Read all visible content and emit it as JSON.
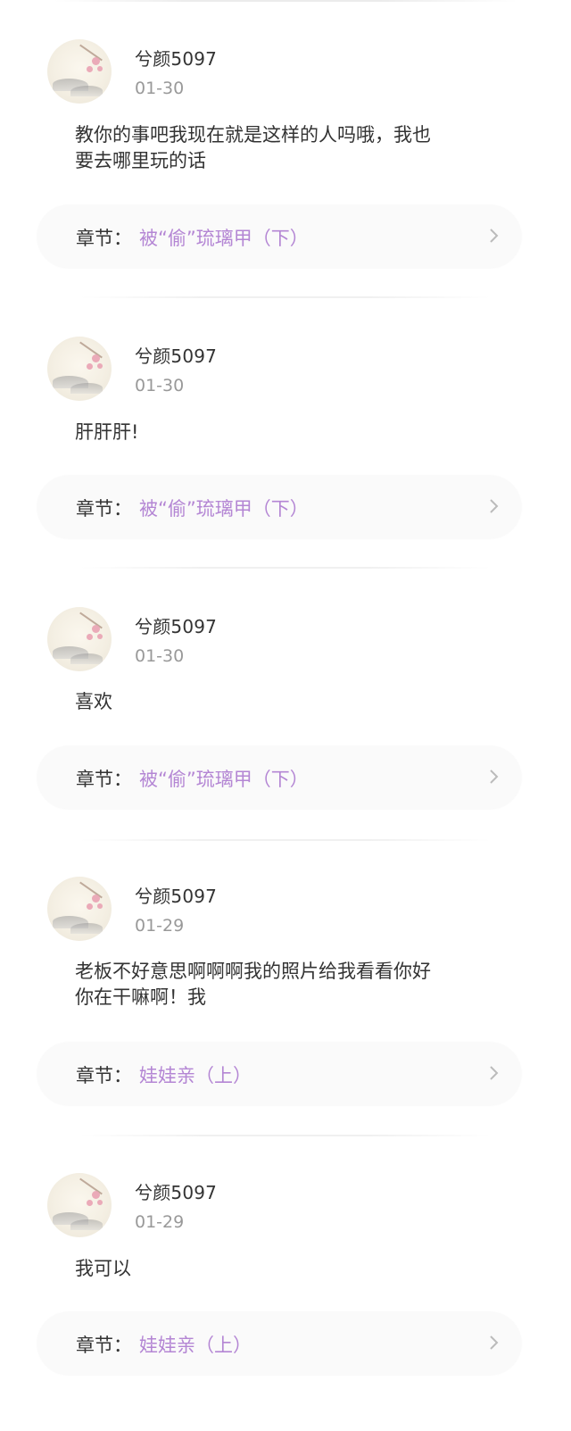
{
  "comments": [
    {
      "username": "兮颜5097",
      "date": "01-30",
      "content_lines": [
        "教你的事吧我现在就是这样的人吗哦，我也",
        "要去哪里玩的话"
      ],
      "chapter_label": "章节：",
      "chapter_title": "被“偷”琉璃甲（下）"
    },
    {
      "username": "兮颜5097",
      "date": "01-30",
      "content_lines": [
        "肝肝肝!"
      ],
      "chapter_label": "章节：",
      "chapter_title": "被“偷”琉璃甲（下）"
    },
    {
      "username": "兮颜5097",
      "date": "01-30",
      "content_lines": [
        "喜欢"
      ],
      "chapter_label": "章节：",
      "chapter_title": "被“偷”琉璃甲（下）"
    },
    {
      "username": "兮颜5097",
      "date": "01-29",
      "content_lines": [
        "老板不好意思啊啊啊我的照片给我看看你好",
        "你在干嘛啊！我"
      ],
      "chapter_label": "章节：",
      "chapter_title": "娃娃亲（上）"
    },
    {
      "username": "兮颜5097",
      "date": "01-29",
      "content_lines": [
        "我可以"
      ],
      "chapter_label": "章节：",
      "chapter_title": "娃娃亲（上）"
    }
  ],
  "icons": {
    "avatar": "ink-painting-avatar",
    "chevron": "chevron-right-icon"
  },
  "colors": {
    "chapter_title": "#b486d4",
    "date": "#999999",
    "text": "#333333",
    "chapter_bg": "#fafafa"
  }
}
